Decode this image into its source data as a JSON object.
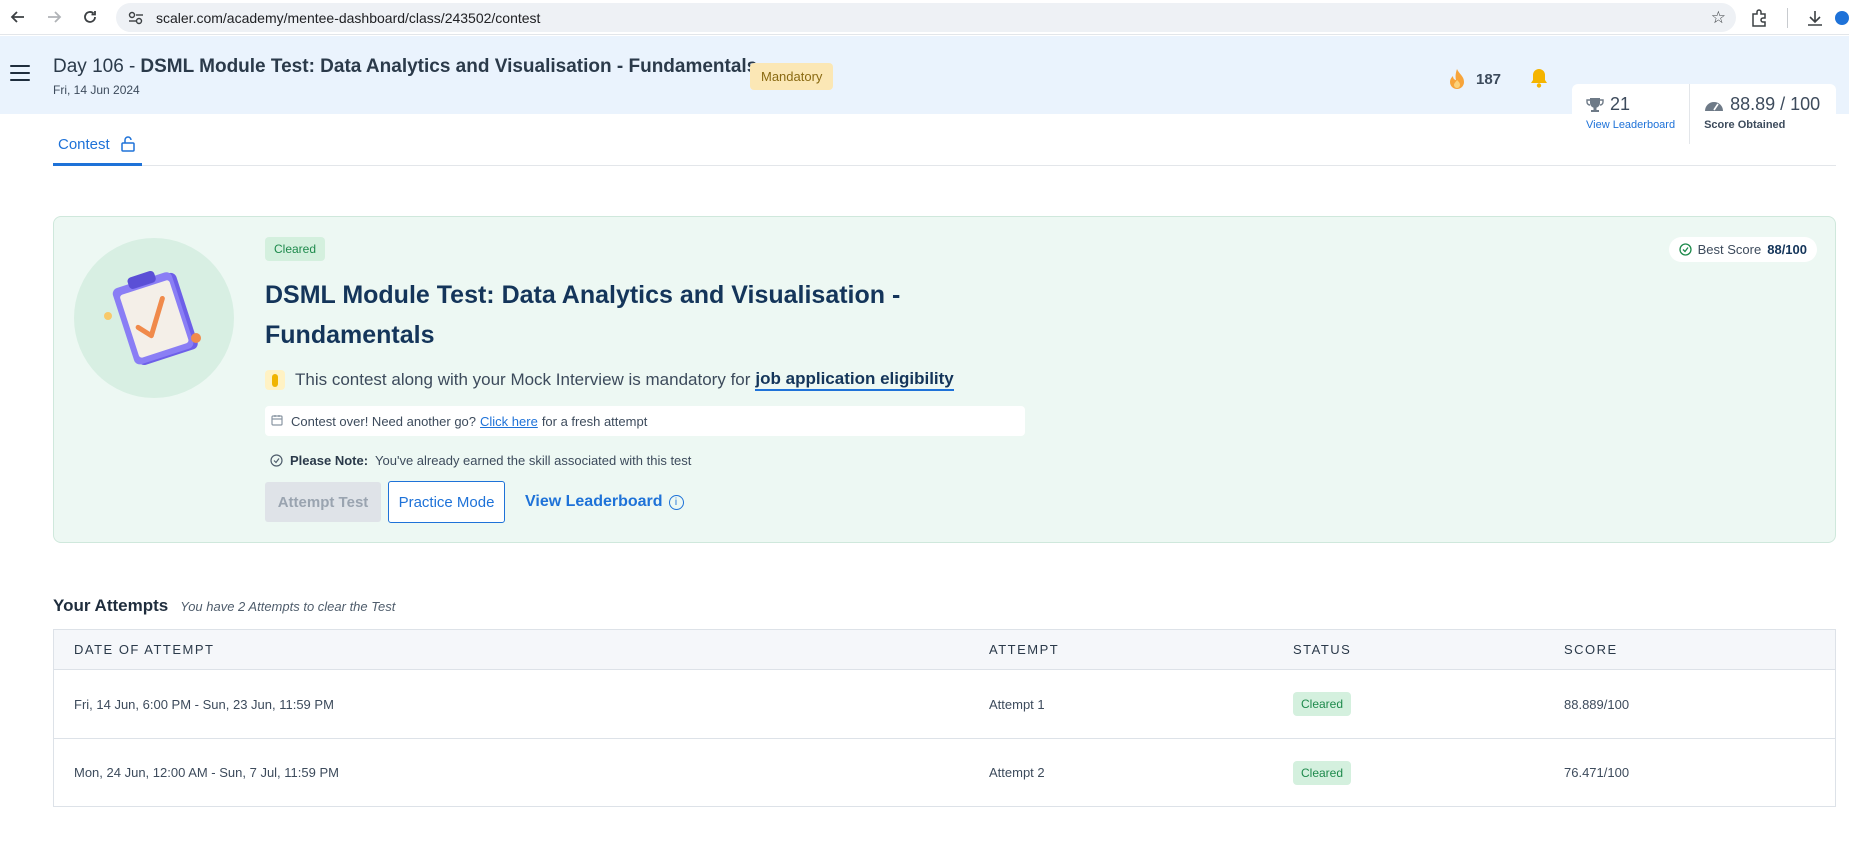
{
  "browser": {
    "url": "scaler.com/academy/mentee-dashboard/class/243502/contest"
  },
  "header": {
    "day": "Day 106 -",
    "title": "DSML Module Test: Data Analytics and Visualisation - Fundamentals",
    "date": "Fri, 14 Jun 2024",
    "badge": "Mandatory",
    "streak": "187",
    "rank": "21",
    "rank_link": "View Leaderboard",
    "score": "88.89 / 100",
    "score_label": "Score Obtained"
  },
  "tabs": [
    {
      "label": "Contest",
      "active": true
    }
  ],
  "contest": {
    "status_badge": "Cleared",
    "title": "DSML Module Test: Data Analytics and Visualisation - Fundamentals",
    "mandatory_text": "This contest along with your Mock Interview is mandatory for",
    "mandatory_link": "job application eligibility",
    "over_text": "Contest over! Need another go?",
    "over_link": "Click here",
    "over_suffix": "for a fresh attempt",
    "note_label": "Please Note:",
    "note_text": "You've already earned the skill associated with this test",
    "btn_attempt": "Attempt Test",
    "btn_practice": "Practice Mode",
    "btn_leaderboard": "View Leaderboard",
    "best_score_label": "Best Score",
    "best_score_value": "88/100"
  },
  "attempts": {
    "title": "Your Attempts",
    "subtitle": "You have 2 Attempts to clear the Test",
    "columns": [
      "DATE OF ATTEMPT",
      "ATTEMPT",
      "STATUS",
      "SCORE"
    ],
    "rows": [
      {
        "date": "Fri, 14 Jun, 6:00 PM - Sun, 23 Jun, 11:59 PM",
        "attempt": "Attempt 1",
        "status": "Cleared",
        "score": "88.889/100"
      },
      {
        "date": "Mon, 24 Jun, 12:00 AM - Sun, 7 Jul, 11:59 PM",
        "attempt": "Attempt 2",
        "status": "Cleared",
        "score": "76.471/100"
      }
    ]
  },
  "colors": {
    "accent": "#1e72d8",
    "success": "#1e8a4c",
    "header_bg": "#eaf3fd",
    "card_bg": "#edf8f3"
  }
}
